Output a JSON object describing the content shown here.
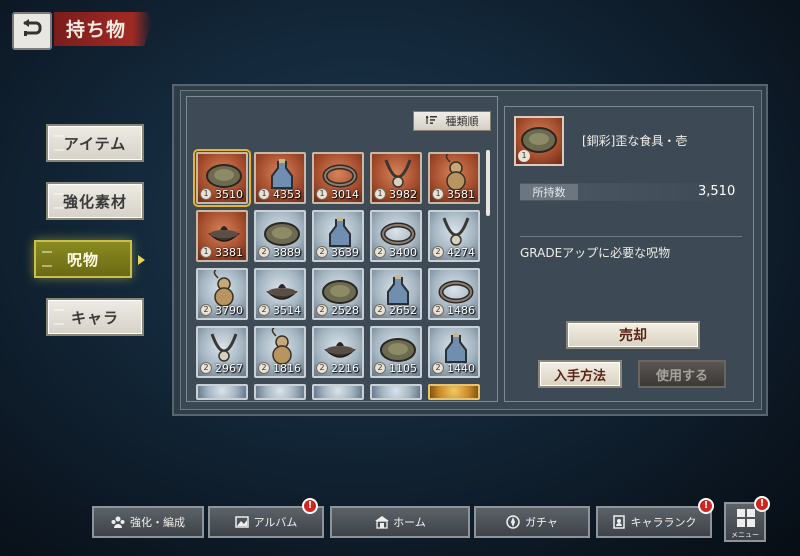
{
  "header": {
    "title": "持ち物",
    "back_icon": "back-arrow-icon"
  },
  "categories": [
    {
      "label": "アイテム",
      "active": false
    },
    {
      "label": "強化素材",
      "active": false
    },
    {
      "label": "呪物",
      "active": true
    },
    {
      "label": "キャラ",
      "active": false
    }
  ],
  "list": {
    "sort_label": "種類順",
    "items": [
      {
        "count": "3510",
        "grade": "1",
        "rarity": "copper",
        "icon": "plate-icon",
        "selected": true
      },
      {
        "count": "4353",
        "grade": "1",
        "rarity": "copper",
        "icon": "bottle-icon"
      },
      {
        "count": "3014",
        "grade": "1",
        "rarity": "copper",
        "icon": "bracelet-icon"
      },
      {
        "count": "3982",
        "grade": "1",
        "rarity": "copper",
        "icon": "necklace-icon"
      },
      {
        "count": "3581",
        "grade": "1",
        "rarity": "copper",
        "icon": "gourd-icon"
      },
      {
        "count": "3381",
        "grade": "1",
        "rarity": "copper",
        "icon": "incense-burner-icon"
      },
      {
        "count": "3889",
        "grade": "2",
        "rarity": "silver",
        "icon": "plate-icon"
      },
      {
        "count": "3639",
        "grade": "2",
        "rarity": "silver",
        "icon": "bottle-icon"
      },
      {
        "count": "3400",
        "grade": "2",
        "rarity": "silver",
        "icon": "bracelet-icon"
      },
      {
        "count": "4274",
        "grade": "2",
        "rarity": "silver",
        "icon": "necklace-icon"
      },
      {
        "count": "3790",
        "grade": "2",
        "rarity": "silver",
        "icon": "gourd-icon"
      },
      {
        "count": "3514",
        "grade": "2",
        "rarity": "silver",
        "icon": "incense-burner-icon"
      },
      {
        "count": "2528",
        "grade": "2",
        "rarity": "silver",
        "icon": "plate-icon"
      },
      {
        "count": "2652",
        "grade": "2",
        "rarity": "silver",
        "icon": "bottle-icon"
      },
      {
        "count": "1486",
        "grade": "2",
        "rarity": "silver",
        "icon": "bracelet-icon"
      },
      {
        "count": "2967",
        "grade": "2",
        "rarity": "silver",
        "icon": "necklace-icon"
      },
      {
        "count": "1816",
        "grade": "2",
        "rarity": "silver",
        "icon": "gourd-icon"
      },
      {
        "count": "2216",
        "grade": "2",
        "rarity": "silver",
        "icon": "incense-burner-icon"
      },
      {
        "count": "1105",
        "grade": "2",
        "rarity": "silver",
        "icon": "plate-icon"
      },
      {
        "count": "1440",
        "grade": "2",
        "rarity": "silver",
        "icon": "bottle-icon"
      }
    ]
  },
  "detail": {
    "name": "[銅彩]歪な食具・壱",
    "grade": "1",
    "qty_label": "所持数",
    "qty_value": "3,510",
    "grade_requirement": "GRADEアップに必要な呪物",
    "sell_label": "売却",
    "obtain_label": "入手方法",
    "use_label": "使用する"
  },
  "bottom_nav": [
    {
      "label": "強化・編成",
      "icon": "team-icon",
      "badge": false
    },
    {
      "label": "アルバム",
      "icon": "album-icon",
      "badge": true
    },
    {
      "label": "ホーム",
      "icon": "home-icon",
      "badge": false
    },
    {
      "label": "ガチャ",
      "icon": "gacha-icon",
      "badge": false
    },
    {
      "label": "キャラランク",
      "icon": "rank-icon",
      "badge": true
    }
  ],
  "menu": {
    "label": "メニュー",
    "badge": true
  },
  "badge_glyph": "!",
  "colors": {
    "active_category": "#7a7a1a",
    "copper": "#a8502f",
    "silver": "#a5b6c2",
    "badge": "#d0261f",
    "title_banner": "#a02a24"
  }
}
